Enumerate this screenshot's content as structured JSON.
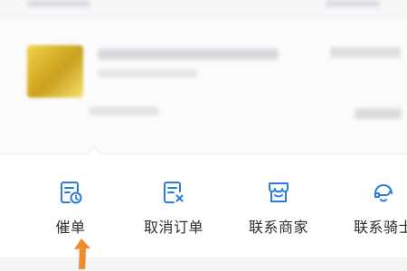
{
  "theme": {
    "accent": "#2c7be5",
    "arrow": "#f08a2e",
    "text": "#2b2e33"
  },
  "actions": [
    {
      "label": "催单",
      "icon": "urge-order-icon"
    },
    {
      "label": "取消订单",
      "icon": "cancel-order-icon"
    },
    {
      "label": "联系商家",
      "icon": "contact-merchant-icon"
    },
    {
      "label": "联系骑士",
      "icon": "contact-rider-icon"
    }
  ]
}
